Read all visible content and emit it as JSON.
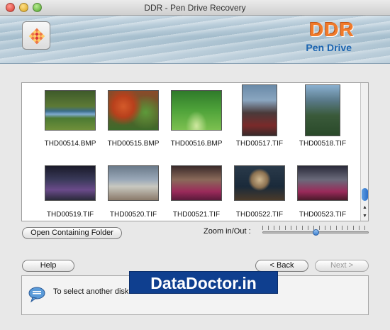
{
  "window": {
    "title": "DDR - Pen Drive Recovery"
  },
  "header": {
    "brand": "DDR",
    "subtitle": "Pen Drive"
  },
  "gallery": {
    "items": [
      {
        "name": "THD00514.BMP"
      },
      {
        "name": "THD00515.BMP"
      },
      {
        "name": "THD00516.BMP"
      },
      {
        "name": "THD00517.TIF"
      },
      {
        "name": "THD00518.TIF"
      },
      {
        "name": "THD00519.TIF"
      },
      {
        "name": "THD00520.TIF"
      },
      {
        "name": "THD00521.TIF"
      },
      {
        "name": "THD00522.TIF"
      },
      {
        "name": "THD00523.TIF"
      }
    ]
  },
  "controls": {
    "open_folder_label": "Open Containing Folder",
    "zoom_label": "Zoom in/Out :",
    "zoom_level": 0.5
  },
  "nav": {
    "help_label": "Help",
    "back_label": "< Back",
    "next_label": "Next >"
  },
  "info": {
    "text": "To select another disk"
  },
  "watermark": {
    "text": "DataDoctor.in"
  },
  "colors": {
    "brand": "#f07a2a",
    "subtitle": "#1b64b0",
    "watermark_bg": "#0f3f8f"
  }
}
